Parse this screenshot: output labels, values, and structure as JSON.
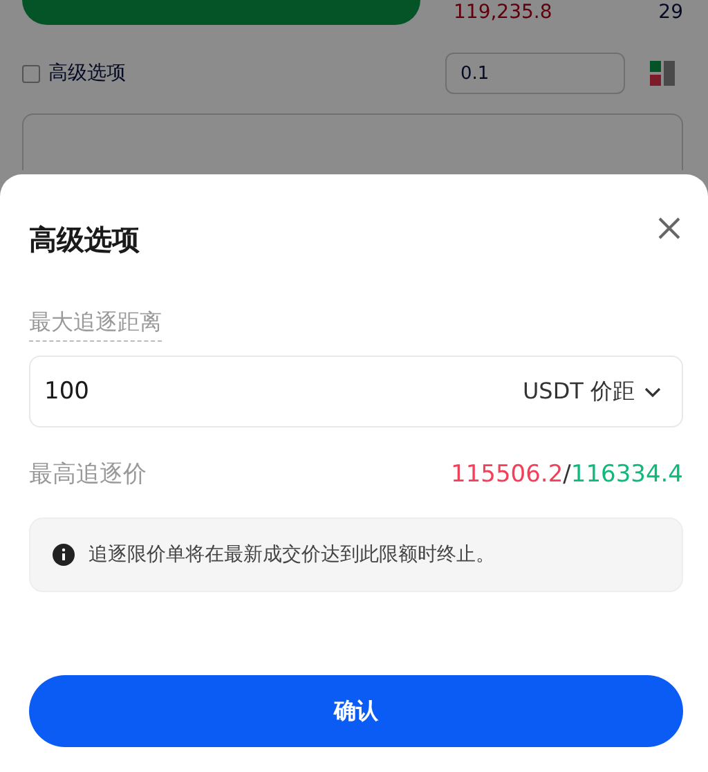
{
  "background": {
    "price": "119,235.8",
    "amount": "29",
    "advanced_checkbox": {
      "label": "高级选项",
      "checked": false
    },
    "step_select": {
      "value": "0.1"
    }
  },
  "sheet": {
    "title": "高级选项",
    "distance_label": "最大追逐距离",
    "distance_input": {
      "value": "100",
      "unit": "USDT 价距"
    },
    "max_price_label": "最高追逐价",
    "max_price_low": "115506.2",
    "separator": "/",
    "max_price_high": "116334.4",
    "notice": "追逐限价单将在最新成交价达到此限额时终止。",
    "confirm_button": "确认"
  }
}
